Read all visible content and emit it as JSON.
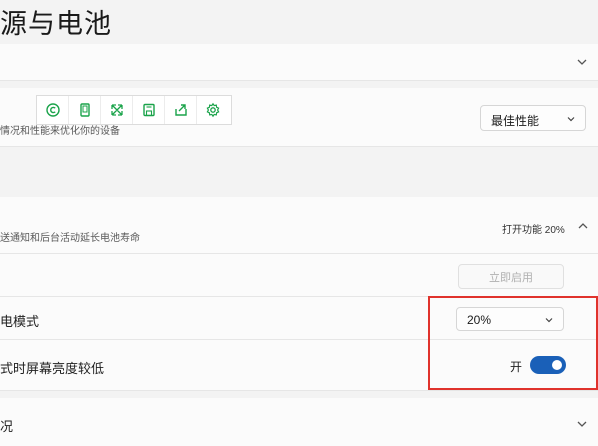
{
  "page": {
    "title": "源与电池"
  },
  "section_top": {
    "label": ""
  },
  "toolbar": {
    "icons": [
      "copyright-icon",
      "tablet-icon",
      "expand-icon",
      "save-icon",
      "share-icon",
      "settings-icon"
    ]
  },
  "power_mode": {
    "description": "情况和性能来优化你的设备",
    "value": "最佳性能"
  },
  "battery_saver": {
    "description": "送通知和后台活动延长电池寿命",
    "status": "打开功能 20%",
    "turn_on_now_label": "立即启用",
    "auto_on_label": "电模式",
    "auto_on_value": "20%",
    "lower_brightness_label": "式时屏幕亮度较低",
    "lower_brightness_state_label": "开",
    "lower_brightness_on": true
  },
  "usage": {
    "label": "况"
  },
  "colors": {
    "accent": "#1a60b8",
    "icon_green": "#1aa34a",
    "highlight": "#e0322c"
  }
}
